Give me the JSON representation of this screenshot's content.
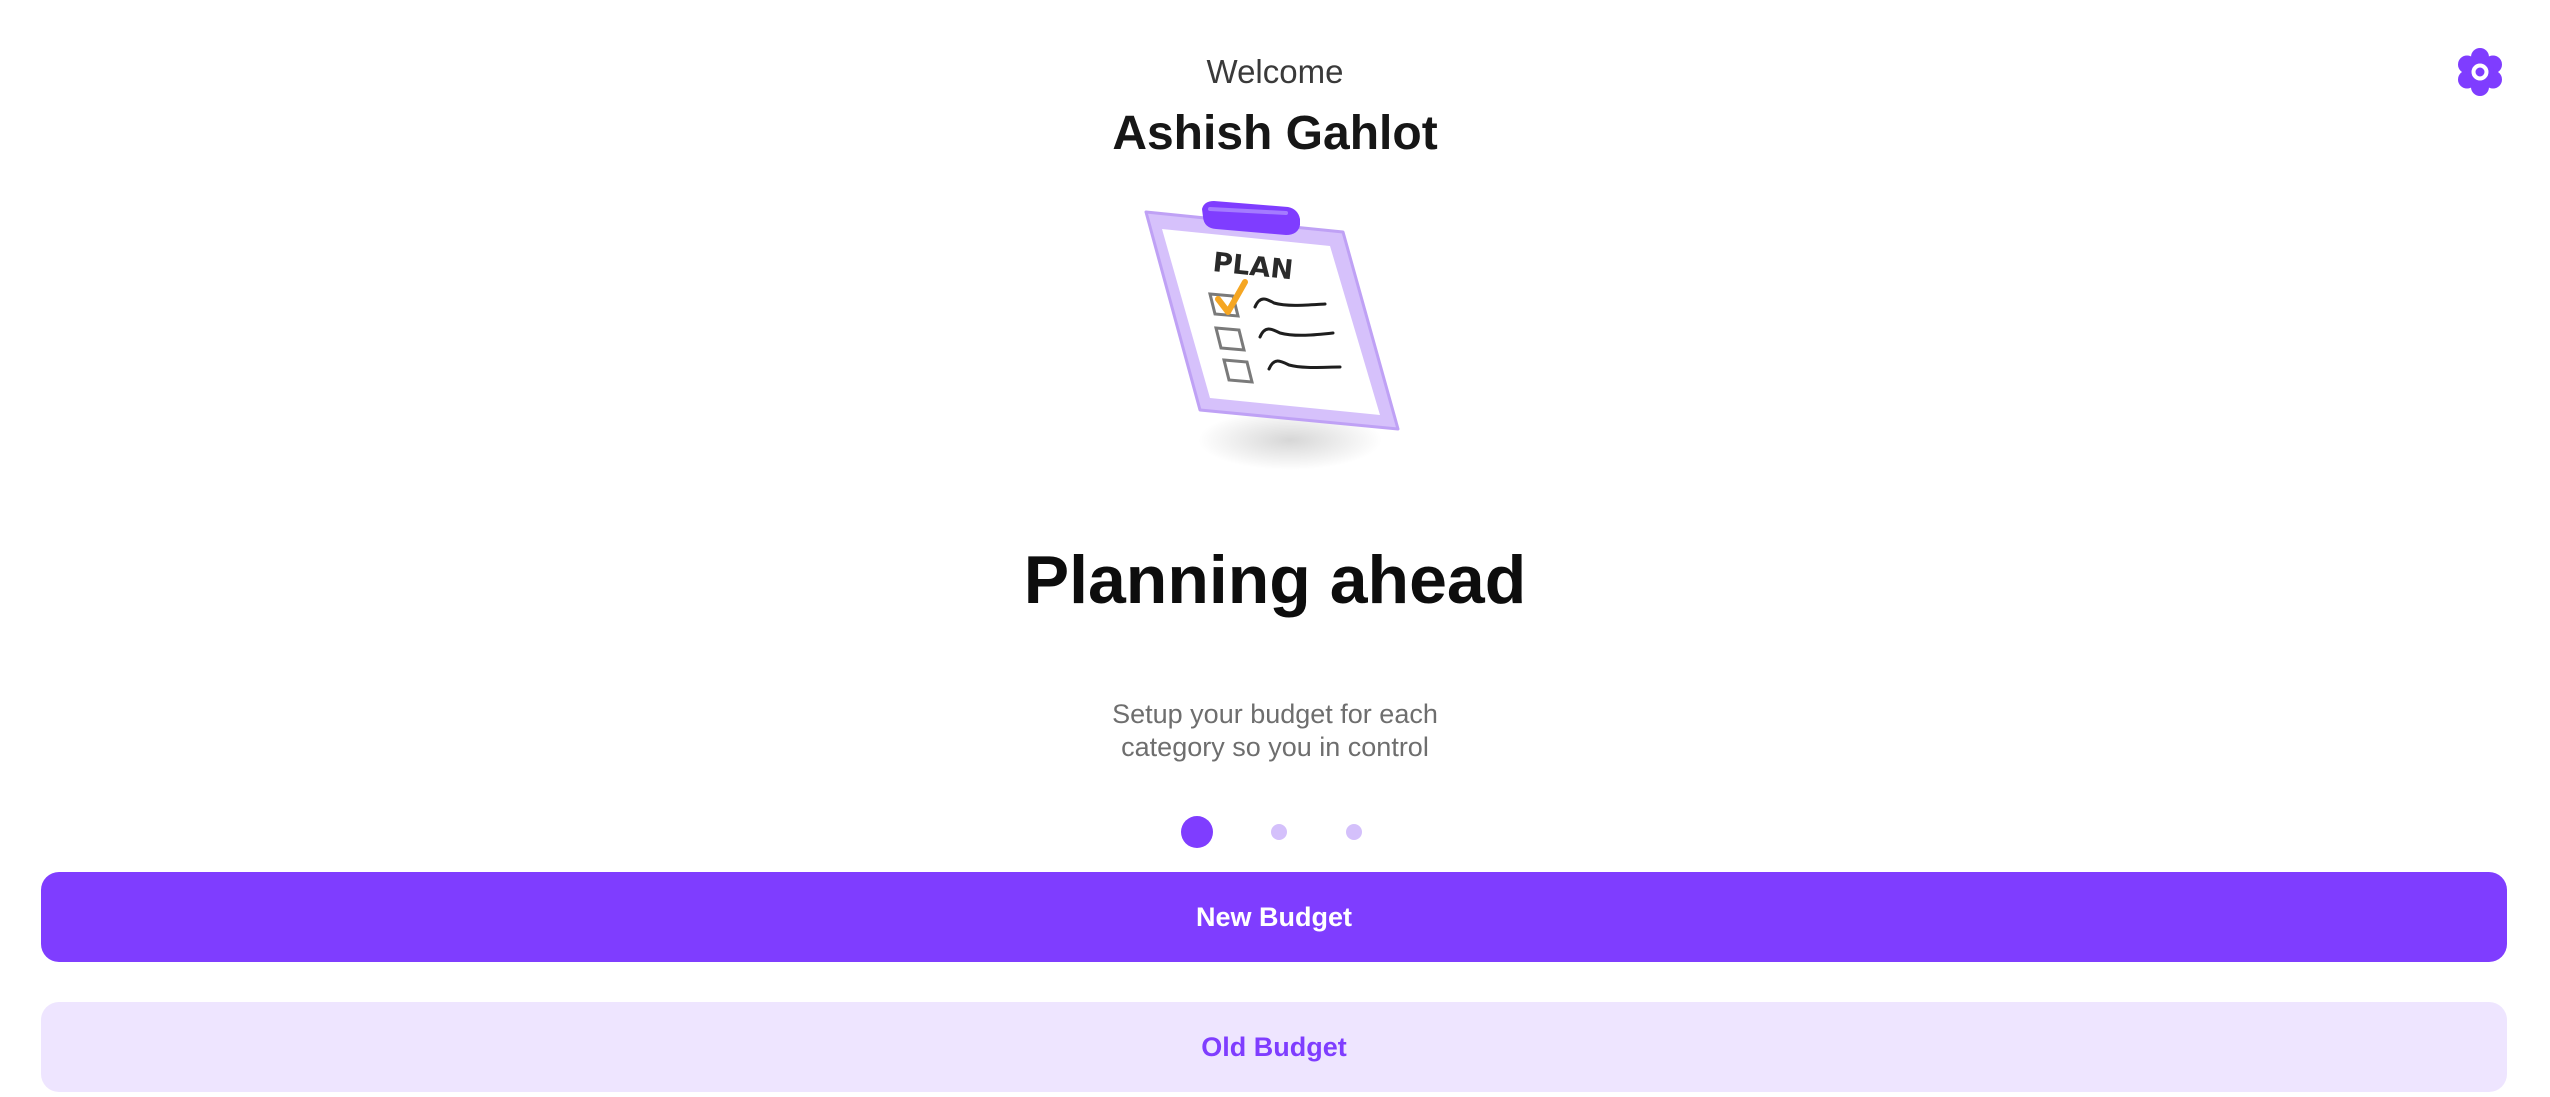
{
  "header": {
    "welcome_label": "Welcome",
    "user_name": "Ashish Gahlot",
    "settings_icon": "gear-icon"
  },
  "onboarding": {
    "illustration_icon": "plan-clipboard-illustration",
    "illustration_label": "PLAN",
    "headline": "Planning ahead",
    "description": "Setup your budget for each category so you in control",
    "slides_total": 3,
    "active_slide": 1
  },
  "actions": {
    "new_budget_label": "New Budget",
    "old_budget_label": "Old Budget"
  },
  "colors": {
    "accent": "#7f3dff",
    "accent_light": "#eee5ff",
    "dot_inactive": "#d4c0fb",
    "check_mark": "#f5a623"
  }
}
